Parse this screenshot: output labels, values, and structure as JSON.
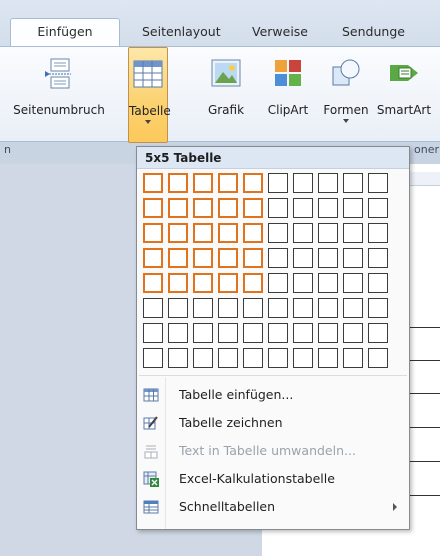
{
  "tabs": [
    {
      "label": "Einfügen",
      "active": true
    },
    {
      "label": "Seitenlayout",
      "active": false
    },
    {
      "label": "Verweise",
      "active": false
    },
    {
      "label": "Sendunge",
      "active": false
    }
  ],
  "ribbon": {
    "buttons": [
      {
        "label": "Seitenumbruch",
        "icon": "page-break-icon",
        "pressed": false,
        "dropdown": false
      },
      {
        "label": "Tabelle",
        "icon": "table-icon",
        "pressed": true,
        "dropdown": true
      },
      {
        "label": "Grafik",
        "icon": "picture-icon",
        "pressed": false,
        "dropdown": false
      },
      {
        "label": "ClipArt",
        "icon": "clipart-icon",
        "pressed": false,
        "dropdown": false
      },
      {
        "label": "Formen",
        "icon": "shapes-icon",
        "pressed": false,
        "dropdown": true
      },
      {
        "label": "SmartArt",
        "icon": "smartart-icon",
        "pressed": false,
        "dropdown": false
      }
    ],
    "group_left": "n",
    "group_right": "oner"
  },
  "table_menu": {
    "title": "5x5 Tabelle",
    "grid_columns": 10,
    "grid_rows": 8,
    "selected_columns": 5,
    "selected_rows": 5,
    "highlight_color": "#e0731d",
    "items": [
      {
        "label": "Tabelle einfügen...",
        "icon": "insert-table-icon",
        "disabled": false,
        "submenu": false
      },
      {
        "label": "Tabelle zeichnen",
        "icon": "draw-table-icon",
        "disabled": false,
        "submenu": false
      },
      {
        "label": "Text in Tabelle umwandeln...",
        "icon": "convert-text-icon",
        "disabled": true,
        "submenu": false
      },
      {
        "label": "Excel-Kalkulationstabelle",
        "icon": "excel-table-icon",
        "disabled": false,
        "submenu": false
      },
      {
        "label": "Schnelltabellen",
        "icon": "quick-tables-icon",
        "disabled": false,
        "submenu": true
      }
    ]
  }
}
